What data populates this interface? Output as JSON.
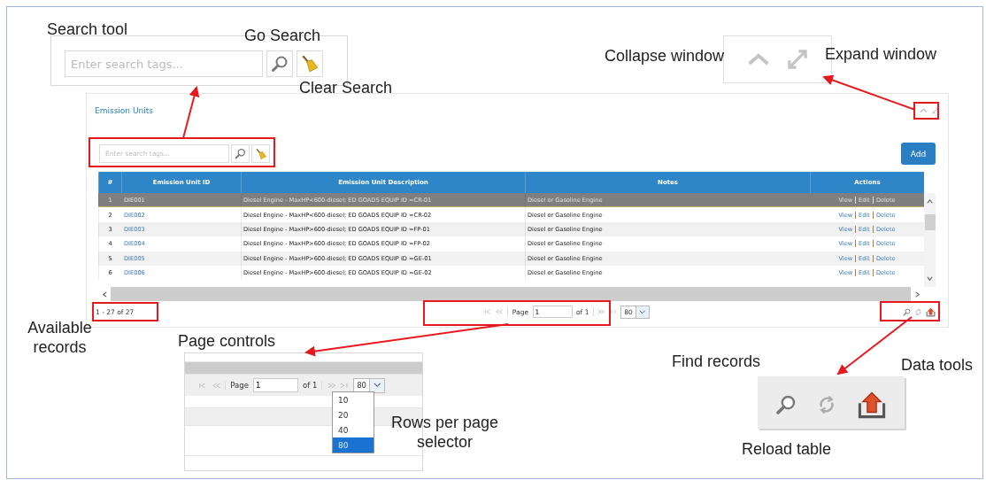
{
  "callouts": [
    "Search tool",
    "Go Search",
    "Clear Search",
    "Collapse window",
    "Expand window",
    "Available records",
    "Page controls",
    "Find records",
    "Data tools",
    "Rows per page selector",
    "Reload table"
  ],
  "search_inset": {
    "placeholder": "Enter search tags..."
  },
  "panel": {
    "title": "Emission Units",
    "search": {
      "placeholder": "Enter search tags..."
    },
    "add_button": "Add",
    "table": {
      "columns": [
        "#",
        "Emission Unit ID",
        "Emission Unit Description",
        "Notes",
        "Actions"
      ],
      "rows": [
        {
          "number": "1",
          "id": "DIE001",
          "description": "Diesel Engine - MaxHP<600-diesel; ED GOADS EQUIP ID =CR-01",
          "notes": "Diesel or Gasoline Engine",
          "actions": [
            "View",
            "Edit",
            "Delete"
          ],
          "selected": true
        },
        {
          "number": "2",
          "id": "DIE002",
          "description": "Diesel Engine - MaxHP<600-diesel; ED GOADS EQUIP ID =CR-02",
          "notes": "Diesel or Gasoline Engine",
          "actions": [
            "View",
            "Edit",
            "Delete"
          ],
          "selected": false
        },
        {
          "number": "3",
          "id": "DIE003",
          "description": "Diesel Engine - MaxHP>600-diesel; ED GOADS EQUIP ID =FP-01",
          "notes": "Diesel or Gasoline Engine",
          "actions": [
            "View",
            "Edit",
            "Delete"
          ],
          "selected": false
        },
        {
          "number": "4",
          "id": "DIE004",
          "description": "Diesel Engine - MaxHP>600-diesel; ED GOADS EQUIP ID =FP-02",
          "notes": "Diesel or Gasoline Engine",
          "actions": [
            "View",
            "Edit",
            "Delete"
          ],
          "selected": false
        },
        {
          "number": "5",
          "id": "DIE005",
          "description": "Diesel Engine - MaxHP>600-diesel; ED GOADS EQUIP ID =GE-01",
          "notes": "Diesel or Gasoline Engine",
          "actions": [
            "View",
            "Edit",
            "Delete"
          ],
          "selected": false
        },
        {
          "number": "6",
          "id": "DIE006",
          "description": "Diesel Engine - MaxHP>600-diesel; ED GOADS EQUIP ID =GE-02",
          "notes": "Diesel or Gasoline Engine",
          "actions": [
            "View",
            "Edit",
            "Delete"
          ],
          "selected": false
        }
      ]
    },
    "record_count": "1 - 27 of 27",
    "pager": {
      "page_label": "Page",
      "page": "1",
      "of": "of 1",
      "rows_per_page": "80"
    }
  },
  "pager_inset": {
    "page_label": "Page",
    "page": "1",
    "of": "of 1",
    "rows_per_page": "80",
    "options": [
      {
        "label": "10",
        "selected": false
      },
      {
        "label": "20",
        "selected": false
      },
      {
        "label": "40",
        "selected": false
      },
      {
        "label": "80",
        "selected": true
      }
    ]
  }
}
